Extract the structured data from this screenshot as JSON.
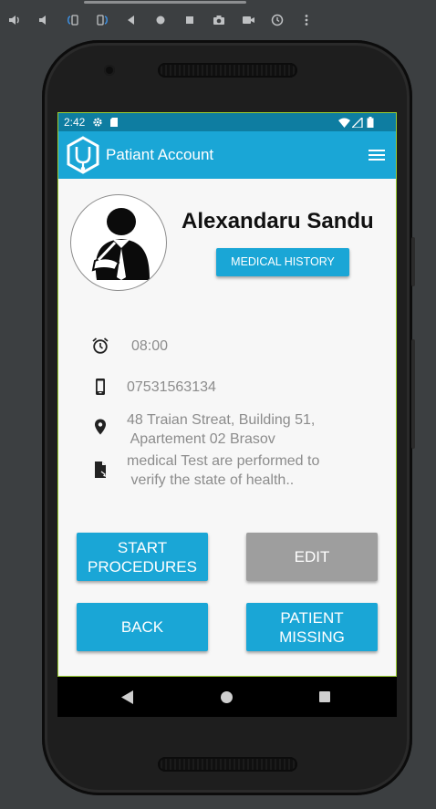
{
  "toolbar": {
    "buttons": [
      "power-icon",
      "volume-up-icon",
      "volume-down-icon",
      "rotate-left-icon",
      "rotate-right-icon",
      "back-icon",
      "home-icon",
      "overview-icon",
      "screenshot-icon",
      "record-icon",
      "snapshot-icon",
      "more-icon"
    ]
  },
  "statusbar": {
    "time": "2:42"
  },
  "appbar": {
    "title": "Patiant Account"
  },
  "patient": {
    "name": "Alexandaru Sandu",
    "medical_history_label": "MEDICAL HISTORY",
    "time": "08:00",
    "phone": "07531563134",
    "address": "48 Traian Streat, Building 51,\n Apartement 02 Brasov",
    "note": "medical Test are performed to\n verify the state of health.."
  },
  "actions": {
    "start_procedures": "START\nPROCEDURES",
    "edit": "EDIT",
    "back": "BACK",
    "patient_missing": "PATIENT\nMISSING"
  },
  "colors": {
    "primary": "#1aa6d6",
    "primary_dark": "#0e7da1",
    "disabled": "#9e9e9e",
    "screen_border": "#9acd32"
  }
}
